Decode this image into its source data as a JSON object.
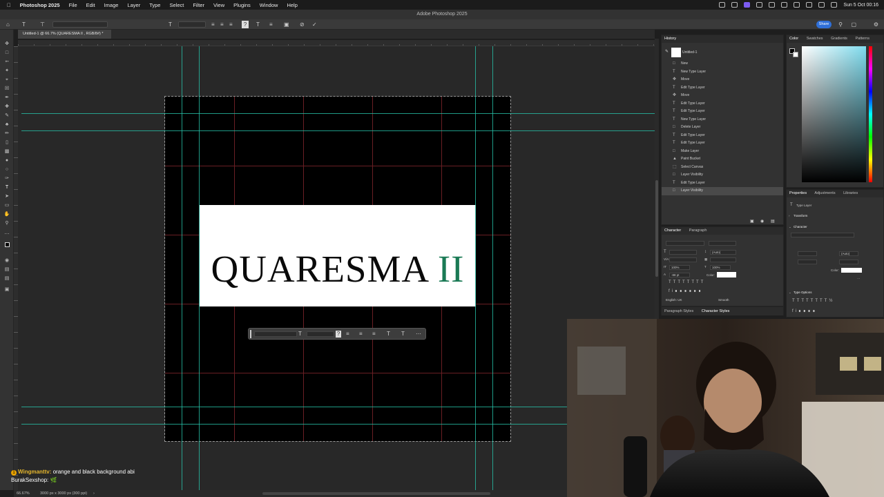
{
  "menubar": {
    "app": "Photoshop 2025",
    "items": [
      "File",
      "Edit",
      "Image",
      "Layer",
      "Type",
      "Select",
      "Filter",
      "View",
      "Plugins",
      "Window",
      "Help"
    ],
    "datetime": "Sun 5 Oct  00:16"
  },
  "window_title": "Adobe Photoshop 2025",
  "options": {
    "share": "Share"
  },
  "doc_tab": "Untitled-1 @ 66.7% (QUARESMA II , RGB/8#) *",
  "canvas": {
    "text_main": "QUARESMA",
    "text_suffix": "II",
    "text_color": "#0a0a0a",
    "suffix_color": "#1a7a55",
    "guide_color": "#27c0a8"
  },
  "history": {
    "title": "History",
    "snapshot": "Untitled-1",
    "items": [
      "New",
      "New Type Layer",
      "Move",
      "Edit Type Layer",
      "Move",
      "Edit Type Layer",
      "Edit Type Layer",
      "New Type Layer",
      "Delete Layer",
      "Edit Type Layer",
      "Edit Type Layer",
      "Make Layer",
      "Paint Bucket",
      "Select Canvas",
      "Layer Visibility",
      "Edit Type Layer",
      "Layer Visibility"
    ]
  },
  "color_panel": {
    "tabs": [
      "Color",
      "Swatches",
      "Gradients",
      "Patterns"
    ]
  },
  "properties": {
    "tabs": [
      "Properties",
      "Adjustments",
      "Libraries"
    ],
    "layer_type": "Type Layer",
    "transform": "Transform",
    "character": "Character",
    "leading": "(Auto)",
    "color_label": "Color:",
    "type_options": "Type Options"
  },
  "character": {
    "tabs": [
      "Character",
      "Paragraph"
    ],
    "leading": "(Auto)",
    "vscale": "100%",
    "hscale": "100%",
    "baseline": "-88 pt",
    "color_label": "Color:",
    "language": "English: UK",
    "aa": "Smooth"
  },
  "styles_tabs": [
    "Paragraph Styles",
    "Character Styles"
  ],
  "status": {
    "zoom": "66.67%",
    "docsize": "3000 px x 3000 px (300 ppi)"
  },
  "chat": [
    {
      "badge": "1",
      "user": "Wingmanttv:",
      "msg": "orange and black background abi"
    },
    {
      "user": "BurakSexshop:",
      "msg": "🌿"
    }
  ]
}
